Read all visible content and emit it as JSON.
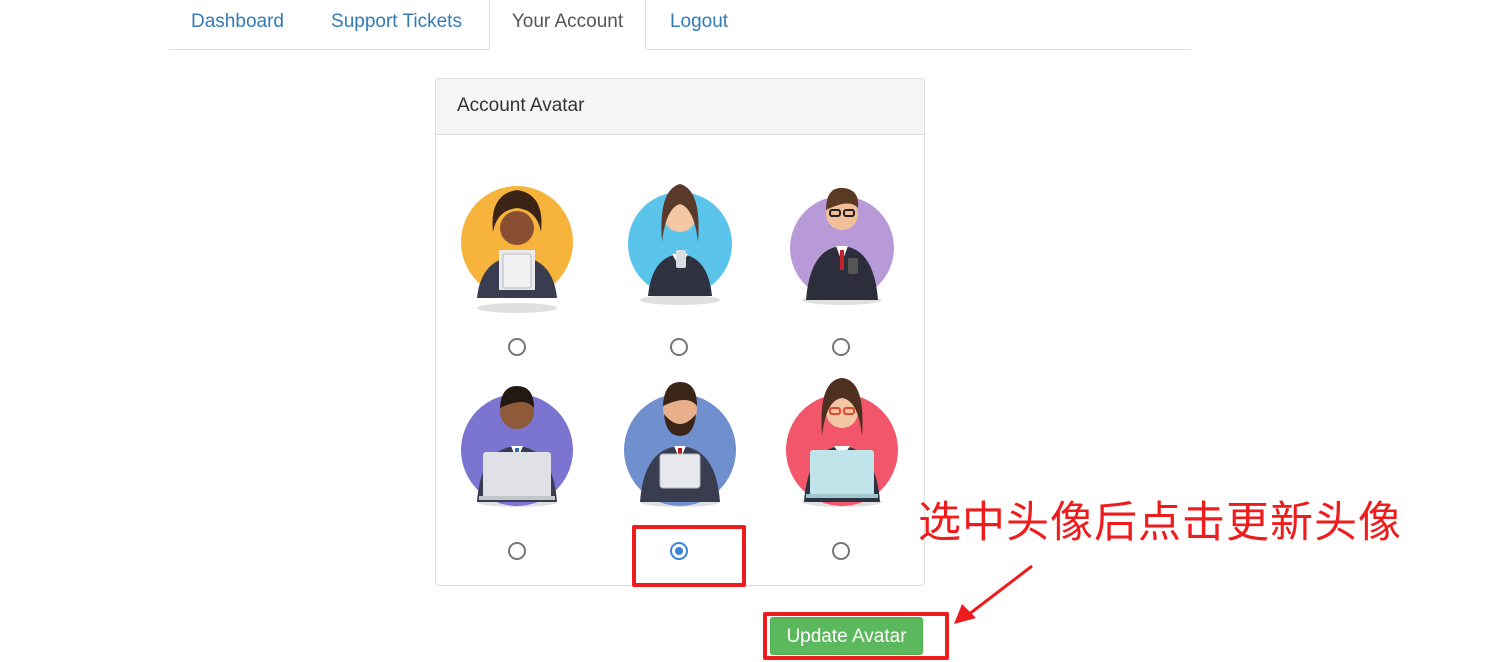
{
  "nav": {
    "tabs": [
      {
        "label": "Dashboard"
      },
      {
        "label": "Support Tickets"
      },
      {
        "label": "Your Account"
      },
      {
        "label": "Logout"
      }
    ],
    "active_tab": "Your Account"
  },
  "panel": {
    "title": "Account Avatar",
    "avatars": [
      {
        "icon": "woman-tablet-avatar-icon",
        "bg": "#f7b43c",
        "selected": false
      },
      {
        "icon": "woman-phone-avatar-icon",
        "bg": "#5bc4ea",
        "selected": false
      },
      {
        "icon": "man-glasses-avatar-icon",
        "bg": "#b99ad8",
        "selected": false
      },
      {
        "icon": "man-laptop-avatar-icon",
        "bg": "#7b74d0",
        "selected": false
      },
      {
        "icon": "bearded-man-tablet-avatar-icon",
        "bg": "#6f8fcf",
        "selected": true
      },
      {
        "icon": "woman-glasses-laptop-avatar-icon",
        "bg": "#f2566b",
        "selected": false
      }
    ]
  },
  "update_button": {
    "label": "Update Avatar",
    "color": "#5cb85c"
  },
  "annotation": {
    "text": "选中头像后点击更新头像",
    "color": "#ee1c1c"
  }
}
